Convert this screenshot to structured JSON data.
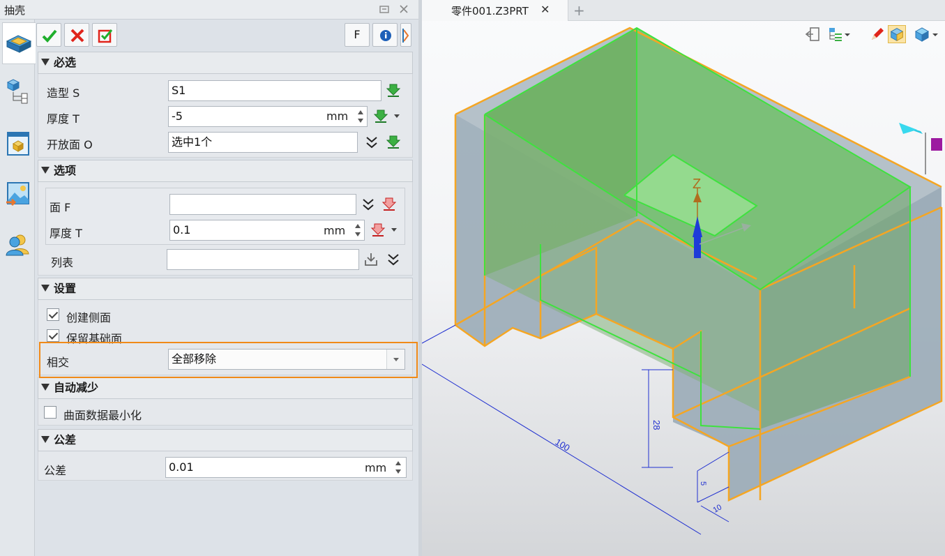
{
  "panel": {
    "title": "抽壳",
    "toolbar": {
      "ok": "确定",
      "cancel": "取消",
      "apply": "应用",
      "f_button": "F",
      "info_button": "i"
    },
    "required": {
      "header": "必选",
      "shape_label": "造型 S",
      "shape_value": "S1",
      "thickness_label": "厚度 T",
      "thickness_value": "-5",
      "thickness_unit": "mm",
      "open_face_label": "开放面 O",
      "open_face_value": "选中1个"
    },
    "options": {
      "header": "选项",
      "face_label": "面 F",
      "face_value": "",
      "thickness_label": "厚度 T",
      "thickness_value": "0.1",
      "thickness_unit": "mm",
      "list_label": "列表",
      "list_value": ""
    },
    "settings": {
      "header": "设置",
      "create_side_label": "创建侧面",
      "create_side_checked": true,
      "keep_base_label": "保留基础面",
      "keep_base_checked": true,
      "intersect_label": "相交",
      "intersect_value": "全部移除"
    },
    "auto_reduce": {
      "header": "自动减少",
      "minimize_label": "曲面数据最小化",
      "minimize_checked": false
    },
    "tolerance": {
      "header": "公差",
      "label": "公差",
      "value": "0.01",
      "unit": "mm"
    }
  },
  "viewport": {
    "tab_label": "零件001.Z3PRT",
    "tab_close": "✕",
    "new_tab": "+",
    "axis_label": "Z",
    "dimensions": {
      "overall": "100",
      "height": "28",
      "small_height": "5",
      "small_depth": "10"
    },
    "colors": {
      "edge_orange": "#f5a623",
      "edge_green": "#3ee23e",
      "dimension_blue": "#2030d0",
      "highlight": "#f08a18"
    }
  }
}
